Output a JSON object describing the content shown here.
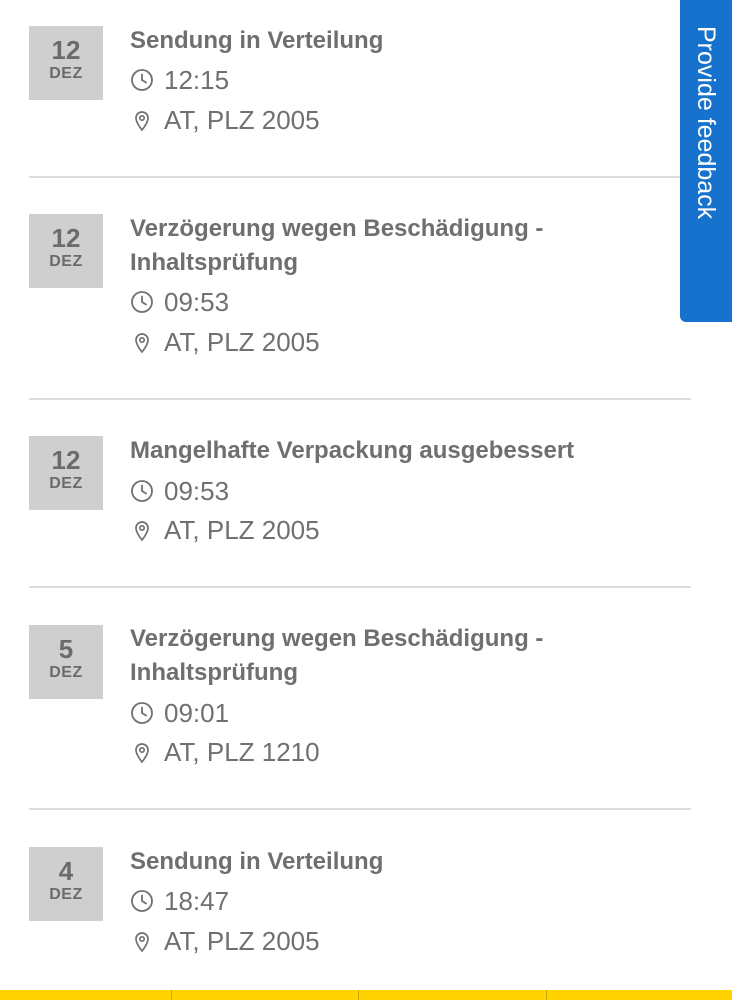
{
  "events": [
    {
      "day": "12",
      "month": "DEZ",
      "title": "Sendung in Verteilung",
      "time": "12:15",
      "location": "AT, PLZ 2005"
    },
    {
      "day": "12",
      "month": "DEZ",
      "title": "Verzögerung wegen Beschädigung - Inhaltsprüfung",
      "time": "09:53",
      "location": "AT, PLZ 2005"
    },
    {
      "day": "12",
      "month": "DEZ",
      "title": "Mangelhafte Verpackung ausgebessert",
      "time": "09:53",
      "location": "AT, PLZ 2005"
    },
    {
      "day": "5",
      "month": "DEZ",
      "title": "Verzögerung wegen Beschädigung - Inhaltsprüfung",
      "time": "09:01",
      "location": "AT, PLZ 1210"
    },
    {
      "day": "4",
      "month": "DEZ",
      "title": "Sendung in Verteilung",
      "time": "18:47",
      "location": "AT, PLZ 2005"
    }
  ],
  "feedback": {
    "label": "Provide feedback"
  },
  "icons": {
    "time": "clock-icon",
    "location": "map-pin-icon"
  },
  "colors": {
    "accent": "#1672cc",
    "brand_bar": "#ffd300",
    "date_box": "#cfcfcf",
    "text": "#6f6f6f"
  }
}
